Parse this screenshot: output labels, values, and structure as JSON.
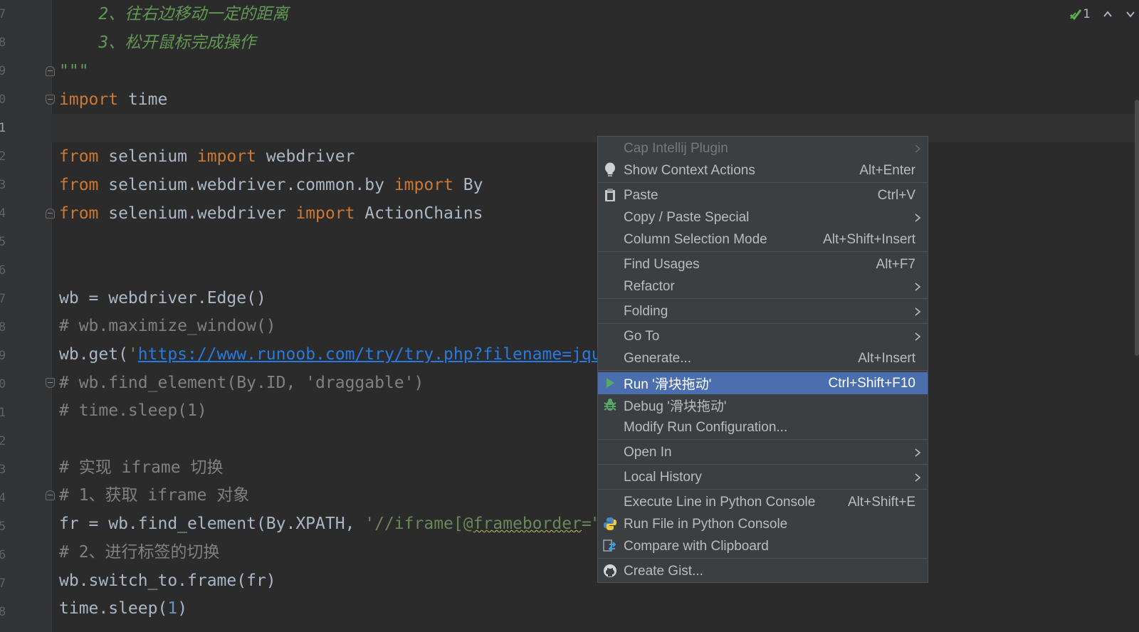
{
  "gutter": {
    "line_numbers": [
      "7",
      "8",
      "9",
      "0",
      "1",
      "2",
      "3",
      "4",
      "5",
      "6",
      "7",
      "8",
      "9",
      "0",
      "1",
      "2",
      "3",
      "4",
      "5",
      "6",
      "7",
      "8"
    ]
  },
  "code": {
    "line1": "    2、往右边移动一定的距离",
    "line2": "    3、松开鼠标完成操作",
    "line3": "\"\"\"",
    "line4_kw": "import",
    "line4_rest": " time",
    "line6_kw1": "from",
    "line6_mod": " selenium ",
    "line6_kw2": "import",
    "line6_name": " webdriver",
    "line7_kw1": "from",
    "line7_mod": " selenium.webdriver.common.by ",
    "line7_kw2": "import",
    "line7_name": " By",
    "line8_kw1": "from",
    "line8_mod": " selenium.webdriver ",
    "line8_kw2": "import",
    "line8_name": " ActionChains",
    "line11": "wb = webdriver.Edge()",
    "line12": "# wb.maximize_window()",
    "line13_pre": "wb.get(",
    "line13_q": "'",
    "line13_url": "https://www.runoob.com/try/try.php?filename=jqu",
    "line14_cm": "# wb.find_element(By.ID, 'draggable')",
    "line15_cm": "# time.sleep(1)",
    "line17_cm": "# 实现 iframe 切换",
    "line18_cm": "# 1、获取 iframe 对象",
    "line19_pre": "fr = wb.find_element(By.XPATH, ",
    "line19_str_a": "'//iframe[@",
    "line19_str_b": "frameborder",
    "line19_str_c": "=\"",
    "line20_cm": "# 2、进行标签的切换",
    "line21": "wb.switch_to.frame(fr)",
    "line22_pre": "time.sleep(",
    "line22_num": "1",
    "line22_post": ")"
  },
  "inspections": {
    "count": "1"
  },
  "context_menu": {
    "items": [
      {
        "label": "Cap Intellij Plugin",
        "shortcut": "",
        "submenu": true,
        "disabled": true
      },
      {
        "label": "Show Context Actions",
        "shortcut": "Alt+Enter",
        "icon": "lightbulb-icon"
      },
      {
        "label": "Paste",
        "shortcut": "Ctrl+V",
        "icon": "clipboard-icon"
      },
      {
        "label": "Copy / Paste Special",
        "shortcut": "",
        "submenu": true
      },
      {
        "label": "Column Selection Mode",
        "shortcut": "Alt+Shift+Insert"
      },
      {
        "label": "Find Usages",
        "shortcut": "Alt+F7"
      },
      {
        "label": "Refactor",
        "shortcut": "",
        "submenu": true
      },
      {
        "label": "Folding",
        "shortcut": "",
        "submenu": true
      },
      {
        "label": "Go To",
        "shortcut": "",
        "submenu": true
      },
      {
        "label": "Generate...",
        "shortcut": "Alt+Insert"
      },
      {
        "label": "Run '滑块拖动'",
        "shortcut": "Ctrl+Shift+F10",
        "icon": "run-icon",
        "selected": true
      },
      {
        "label": "Debug '滑块拖动'",
        "shortcut": "",
        "icon": "debug-icon"
      },
      {
        "label": "Modify Run Configuration...",
        "shortcut": ""
      },
      {
        "label": "Open In",
        "shortcut": "",
        "submenu": true
      },
      {
        "label": "Local History",
        "shortcut": "",
        "submenu": true
      },
      {
        "label": "Execute Line in Python Console",
        "shortcut": "Alt+Shift+E"
      },
      {
        "label": "Run File in Python Console",
        "shortcut": "",
        "icon": "python-icon"
      },
      {
        "label": "Compare with Clipboard",
        "shortcut": "",
        "icon": "compare-icon"
      },
      {
        "label": "Create Gist...",
        "shortcut": "",
        "icon": "github-icon"
      }
    ]
  },
  "colors": {
    "editor_bg": "#2b2b2b",
    "keyword": "#cc7832",
    "comment": "#808080",
    "string": "#6a8759",
    "docstring": "#629755",
    "menu_bg": "#3c3f41",
    "selection": "#4b6eaf"
  }
}
